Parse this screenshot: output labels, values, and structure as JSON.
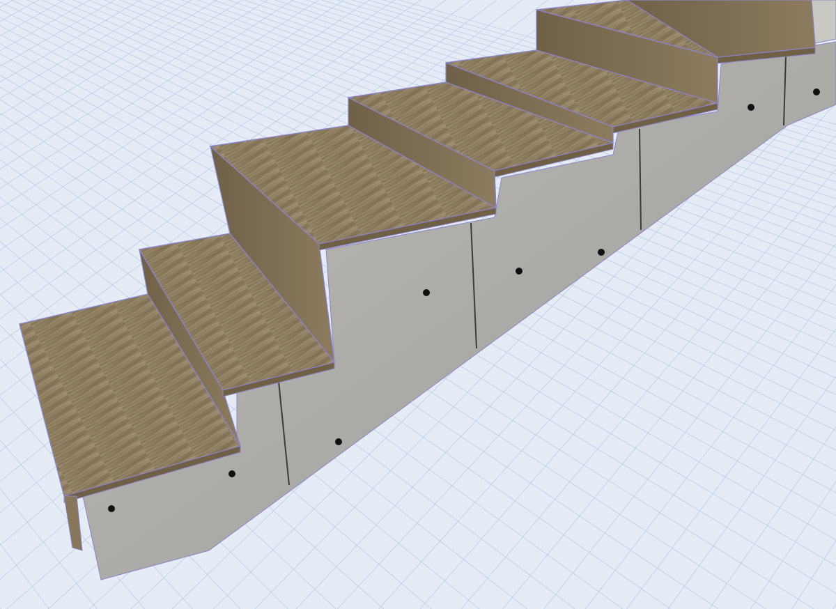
{
  "scene": {
    "view": "3d-perspective",
    "subject": "concrete-stair",
    "step_count": 6,
    "tread_material": "wood-oak",
    "stringer_material": "exposed-concrete",
    "formwork_tie_holes": true,
    "ground": "grid-plane"
  },
  "colors": {
    "background": "#e6ecf6",
    "grid_line": "#b9cbe6",
    "grid_line_strong": "#9fb8de",
    "wood_light": "#9a8a6e",
    "wood_mid": "#877659",
    "wood_dark": "#6e5f45",
    "wood_edge": "#8a7ab8",
    "concrete_light": "#b9b8b4",
    "concrete_mid": "#a8a7a3",
    "concrete_dark": "#8f8e8a",
    "outline": "#8a85c9",
    "joint": "#3a3a3a",
    "tie_hole": "#111111"
  }
}
